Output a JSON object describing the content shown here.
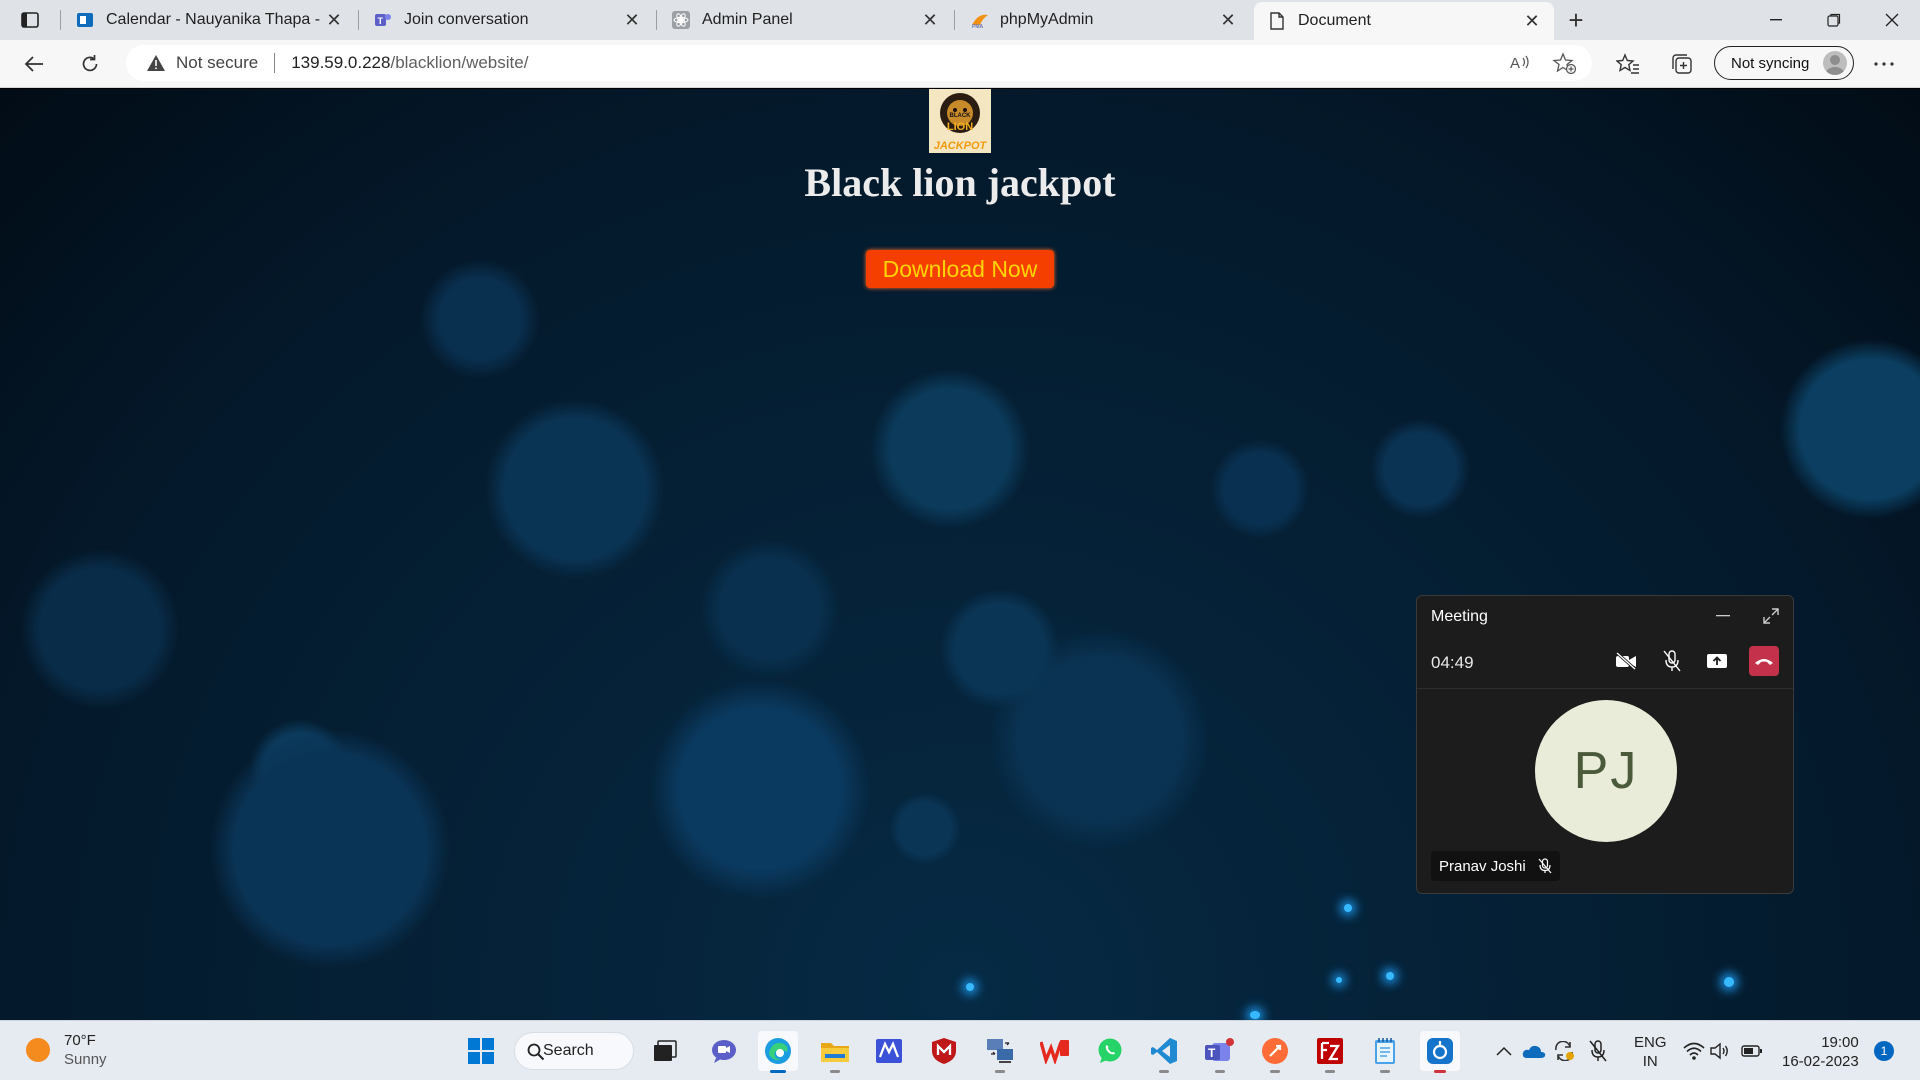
{
  "browser": {
    "tabs": [
      {
        "title": "Calendar - Nauyanika Thapa - Outlook",
        "icon": "outlook-icon",
        "active": false
      },
      {
        "title": "Join conversation",
        "icon": "teams-icon",
        "active": false
      },
      {
        "title": "Admin Panel",
        "icon": "react-icon",
        "active": false
      },
      {
        "title": "phpMyAdmin",
        "icon": "phpmyadmin-icon",
        "active": false
      },
      {
        "title": "Document",
        "icon": "document-icon",
        "active": true
      }
    ],
    "security_label": "Not secure",
    "url_host": "139.59.0.228",
    "url_path": "/blacklion/website/",
    "sync_label": "Not syncing"
  },
  "page": {
    "logo_text": [
      "BLACK",
      "LION",
      "JACKPOT"
    ],
    "title": "Black lion jackpot",
    "download_label": "Download Now"
  },
  "meeting": {
    "title": "Meeting",
    "timer": "04:49",
    "participant_initials": "PJ",
    "participant_name": "Pranav Joshi"
  },
  "taskbar": {
    "weather_temp": "70°F",
    "weather_desc": "Sunny",
    "search_label": "Search",
    "lang_top": "ENG",
    "lang_bottom": "IN",
    "time": "19:00",
    "date": "16-02-2023",
    "notification_count": "1"
  },
  "colors": {
    "download_bg": "#f43f00",
    "download_text": "#ffd400",
    "end_call": "#c4314b",
    "accent": "#0067c0"
  }
}
